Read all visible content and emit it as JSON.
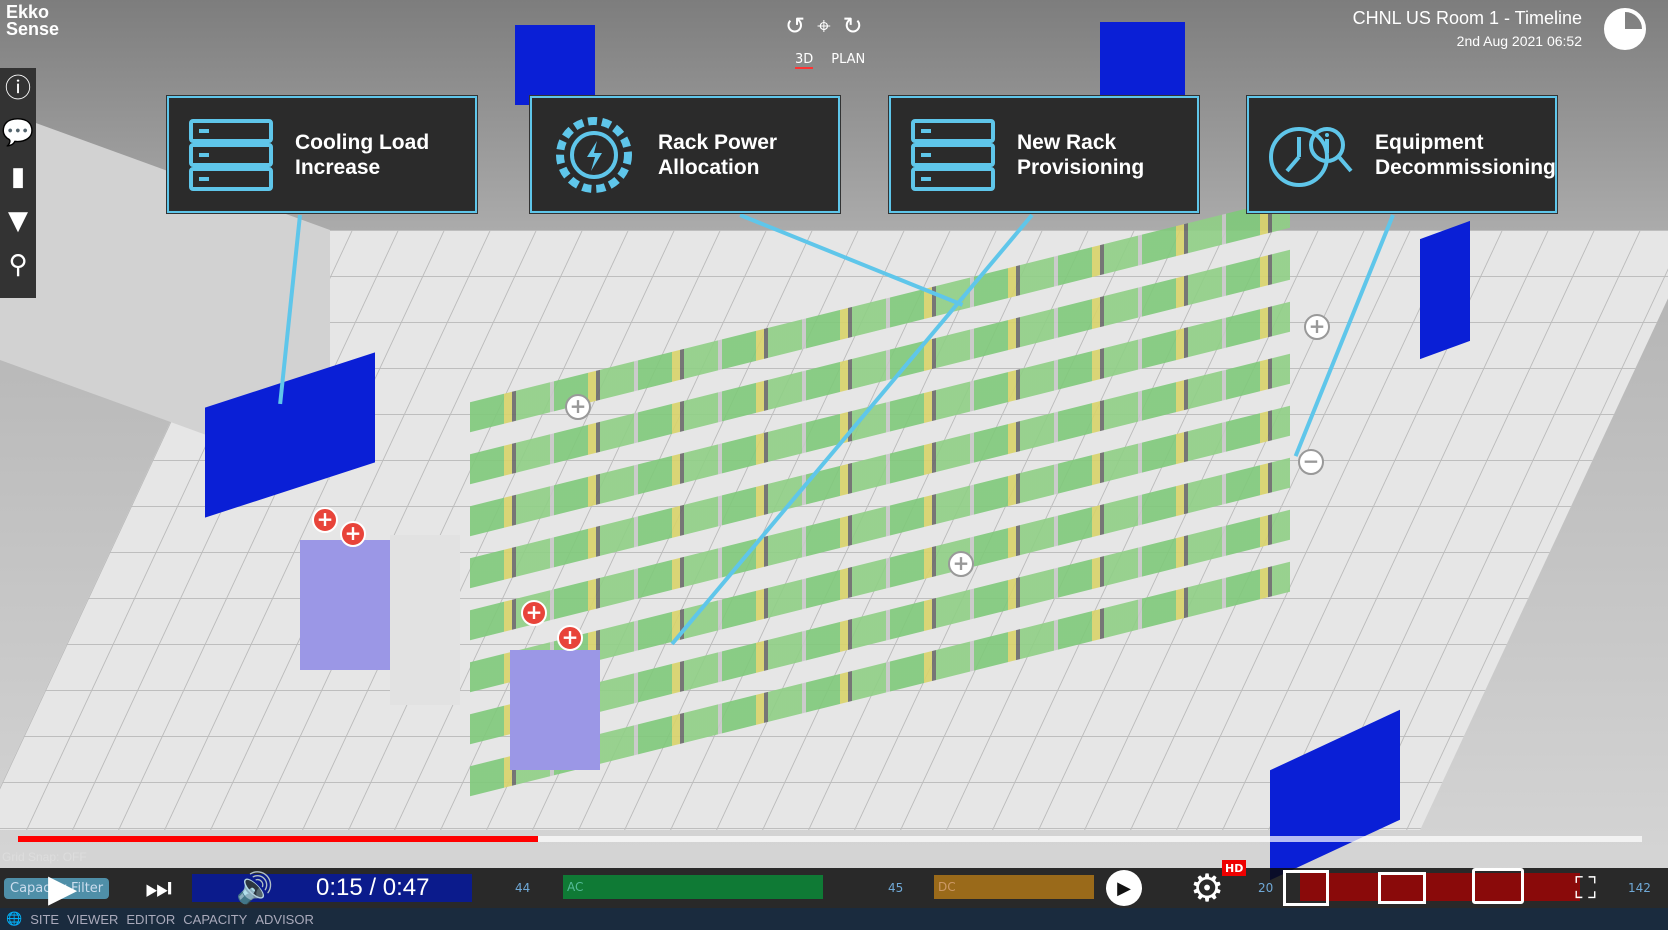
{
  "logo": {
    "text": "Ekko Sense"
  },
  "view_controls": {
    "rotate_left": "↺",
    "center": "⌖",
    "rotate_right": "↻",
    "modes": [
      "3D",
      "PLAN"
    ],
    "active_mode": "3D"
  },
  "timeline": {
    "title": "CHNL US Room 1 - Timeline",
    "date": "2nd Aug 2021 06:52"
  },
  "sidebar": [
    {
      "icon": "info-icon",
      "glyph": "ⓘ"
    },
    {
      "icon": "chat-icon",
      "glyph": "💬"
    },
    {
      "icon": "chart-icon",
      "glyph": "▮"
    },
    {
      "icon": "filter-icon",
      "glyph": "▼"
    },
    {
      "icon": "search-icon",
      "glyph": "⚲"
    }
  ],
  "callouts": [
    {
      "label": "Cooling Load\nIncrease",
      "icon": "server-rack-icon"
    },
    {
      "label": "Rack Power\nAllocation",
      "icon": "power-gear-icon"
    },
    {
      "label": "New Rack\nProvisioning",
      "icon": "server-rack-icon"
    },
    {
      "label": "Equipment\nDecommissioning",
      "icon": "clock-search-icon"
    }
  ],
  "player": {
    "current_time": "0:15",
    "duration": "0:47",
    "time_display": "0:15 / 0:47",
    "progress_percent": 32,
    "hd_badge": "HD",
    "accent": "#ff0000"
  },
  "app_overlay": {
    "grid_snap": "Grid Snap: OFF",
    "capacity_filter": "Capacity Filter",
    "values": [
      "44",
      "AC",
      "45",
      "DC",
      "20",
      "142"
    ]
  },
  "nav": {
    "items": [
      "SITE",
      "VIEWER",
      "EDITOR",
      "CAPACITY",
      "ADVISOR"
    ]
  },
  "colors": {
    "callout_border": "#5fc6ea",
    "callout_bg": "#2b2b2b",
    "rack_green": "#7fc97a",
    "rack_yellow": "#d9d36a",
    "cooling_unit": "#0a1fd6"
  }
}
